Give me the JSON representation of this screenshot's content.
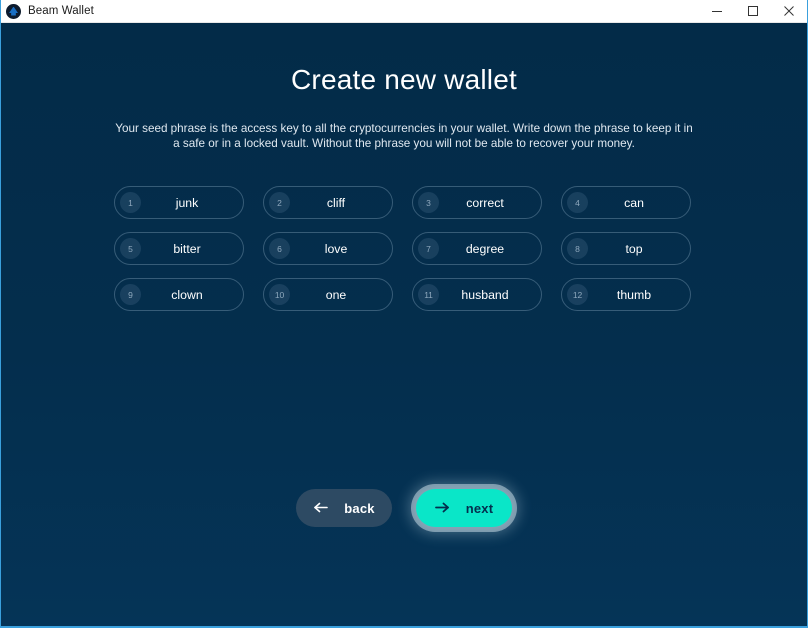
{
  "window": {
    "app_title": "Beam Wallet",
    "app_icon": "beam-logo-icon",
    "controls": {
      "minimize": "minimize-icon",
      "maximize": "maximize-icon",
      "close": "close-icon"
    },
    "border_color": "#3aa0dd"
  },
  "page": {
    "title": "Create new wallet",
    "description": "Your seed phrase is the access key to all the cryptocurrencies in your wallet. Write down the phrase to keep it in a safe or in a locked vault. Without the phrase you will not be able to recover your money.",
    "background_top": "#032b48",
    "background_bottom": "#053457"
  },
  "seed_phrase": {
    "words": [
      {
        "index": "1",
        "word": "junk"
      },
      {
        "index": "2",
        "word": "cliff"
      },
      {
        "index": "3",
        "word": "correct"
      },
      {
        "index": "4",
        "word": "can"
      },
      {
        "index": "5",
        "word": "bitter"
      },
      {
        "index": "6",
        "word": "love"
      },
      {
        "index": "7",
        "word": "degree"
      },
      {
        "index": "8",
        "word": "top"
      },
      {
        "index": "9",
        "word": "clown"
      },
      {
        "index": "10",
        "word": "one"
      },
      {
        "index": "11",
        "word": "husband"
      },
      {
        "index": "12",
        "word": "thumb"
      }
    ]
  },
  "actions": {
    "back": {
      "label": "back",
      "icon": "arrow-left-icon",
      "color": "#2d4a63"
    },
    "next": {
      "label": "next",
      "icon": "arrow-right-icon",
      "color": "#0ae6c8",
      "focused": true
    }
  }
}
